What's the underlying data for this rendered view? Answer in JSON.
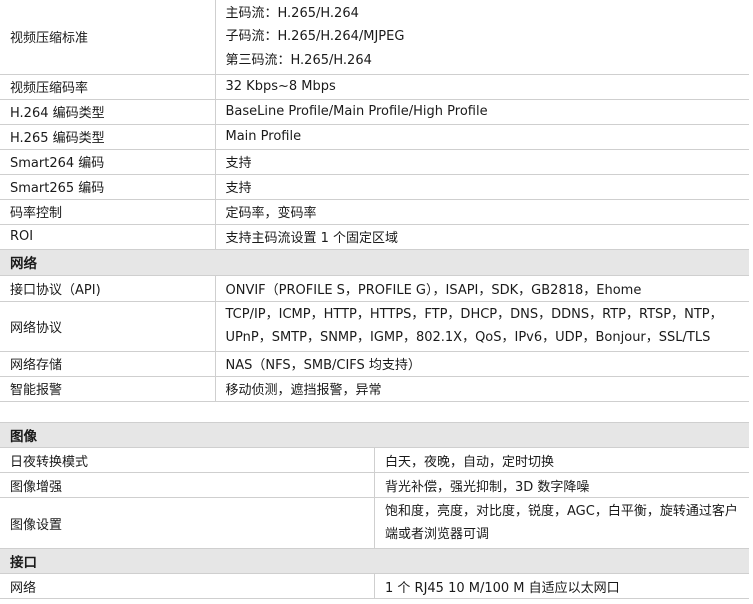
{
  "table1": {
    "compression_standard": {
      "label": "视频压缩标准",
      "lines": [
        "主码流：H.265/H.264",
        "子码流：H.265/H.264/MJPEG",
        "第三码流：H.265/H.264"
      ]
    },
    "rows_a": [
      {
        "label": "视频压缩码率",
        "value": "32 Kbps~8 Mbps"
      },
      {
        "label": "H.264 编码类型",
        "value": "BaseLine Profile/Main Profile/High Profile"
      },
      {
        "label": "H.265 编码类型",
        "value": "Main Profile"
      },
      {
        "label": "Smart264 编码",
        "value": "支持"
      },
      {
        "label": "Smart265 编码",
        "value": "支持"
      },
      {
        "label": "码率控制",
        "value": "定码率，变码率"
      },
      {
        "label": "ROI",
        "value": "支持主码流设置 1 个固定区域"
      }
    ],
    "network_section": "网络",
    "rows_b": [
      {
        "label": "接口协议（API)",
        "value": "ONVIF（PROFILE S，PROFILE G），ISAPI，SDK，GB2818，Ehome"
      },
      {
        "label": "网络协议",
        "lines": [
          "TCP/IP，ICMP，HTTP，HTTPS，FTP，DHCP，DNS，DDNS，RTP，RTSP，NTP，",
          "UPnP，SMTP，SNMP，IGMP，802.1X，QoS，IPv6，UDP，Bonjour，SSL/TLS"
        ]
      },
      {
        "label": "网络存储",
        "value": "NAS（NFS，SMB/CIFS 均支持）"
      },
      {
        "label": "智能报警",
        "value": "移动侦测，遮挡报警，异常"
      }
    ]
  },
  "table2": {
    "image_section": "图像",
    "image_rows": [
      {
        "label": "日夜转换模式",
        "value": "白天，夜晚，自动，定时切换"
      },
      {
        "label": "图像增强",
        "value": "背光补偿，强光抑制，3D 数字降噪"
      },
      {
        "label": "图像设置",
        "value": "饱和度，亮度，对比度，锐度，AGC，白平衡，旋转通过客户端或者浏览器可调"
      }
    ],
    "interface_section": "接口",
    "interface_rows": [
      {
        "label": "网络",
        "value": "1 个 RJ45 10 M/100 M 自适应以太网口"
      }
    ]
  }
}
